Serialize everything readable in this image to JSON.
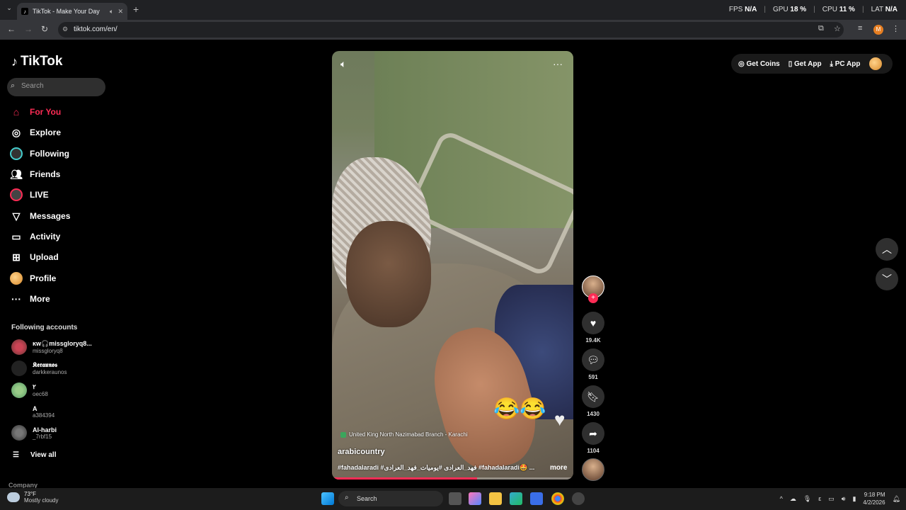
{
  "browser": {
    "tab_title": "TikTok - Make Your Day",
    "url": "tiktok.com/en/",
    "profile_initial": "M",
    "perf": [
      {
        "label": "FPS",
        "value": "N/A"
      },
      {
        "label": "GPU",
        "value": "18 %"
      },
      {
        "label": "CPU",
        "value": "11 %"
      },
      {
        "label": "LAT",
        "value": "N/A"
      }
    ]
  },
  "sidebar": {
    "logo": "TikTok",
    "search_placeholder": "Search",
    "menu": [
      {
        "label": "For You",
        "icon": "home-icon"
      },
      {
        "label": "Explore",
        "icon": "compass-icon"
      },
      {
        "label": "Following",
        "icon": "following-avatar-icon"
      },
      {
        "label": "Friends",
        "icon": "friends-icon"
      },
      {
        "label": "LIVE",
        "icon": "live-avatar-icon"
      },
      {
        "label": "Messages",
        "icon": "send-icon"
      },
      {
        "label": "Activity",
        "icon": "activity-icon"
      },
      {
        "label": "Upload",
        "icon": "plus-box-icon"
      },
      {
        "label": "Profile",
        "icon": "profile-avatar-icon"
      },
      {
        "label": "More",
        "icon": "ellipsis-icon"
      }
    ],
    "following_title": "Following accounts",
    "accounts": [
      {
        "name": "ĸw🎧missgloryq8...",
        "handle": "missgloryq8"
      },
      {
        "name": "𝕶𝖊𝖗𝖆𝖚𝖓𝖔𝖘",
        "handle": "darkkeraunos"
      },
      {
        "name": "٢",
        "handle": "oec68"
      },
      {
        "name": "A",
        "handle": "a384394"
      },
      {
        "name": "Al-harbi",
        "handle": "_7rbf15"
      }
    ],
    "view_all": "View all",
    "company": "Company"
  },
  "video": {
    "location": "United King North Nazimabad Branch - Karachi",
    "username": "arabicountry",
    "description": "#fahadalaradi #فهد_العرادی #یومیات_فهد_العرادی #fahadalaradi🤩 ...",
    "more": "more",
    "emoji": "😂😂",
    "progress": 0.6
  },
  "actions": {
    "likes": "19.4K",
    "comments": "591",
    "saves": "1430",
    "shares": "1104"
  },
  "topright": {
    "coins": "Get Coins",
    "app": "Get App",
    "pc": "PC App"
  },
  "taskbar": {
    "temp": "73°F",
    "weather": "Mostly cloudy",
    "search": "Search",
    "lang": "ε",
    "time": "9:18 PM",
    "date": "4/2/2026"
  }
}
